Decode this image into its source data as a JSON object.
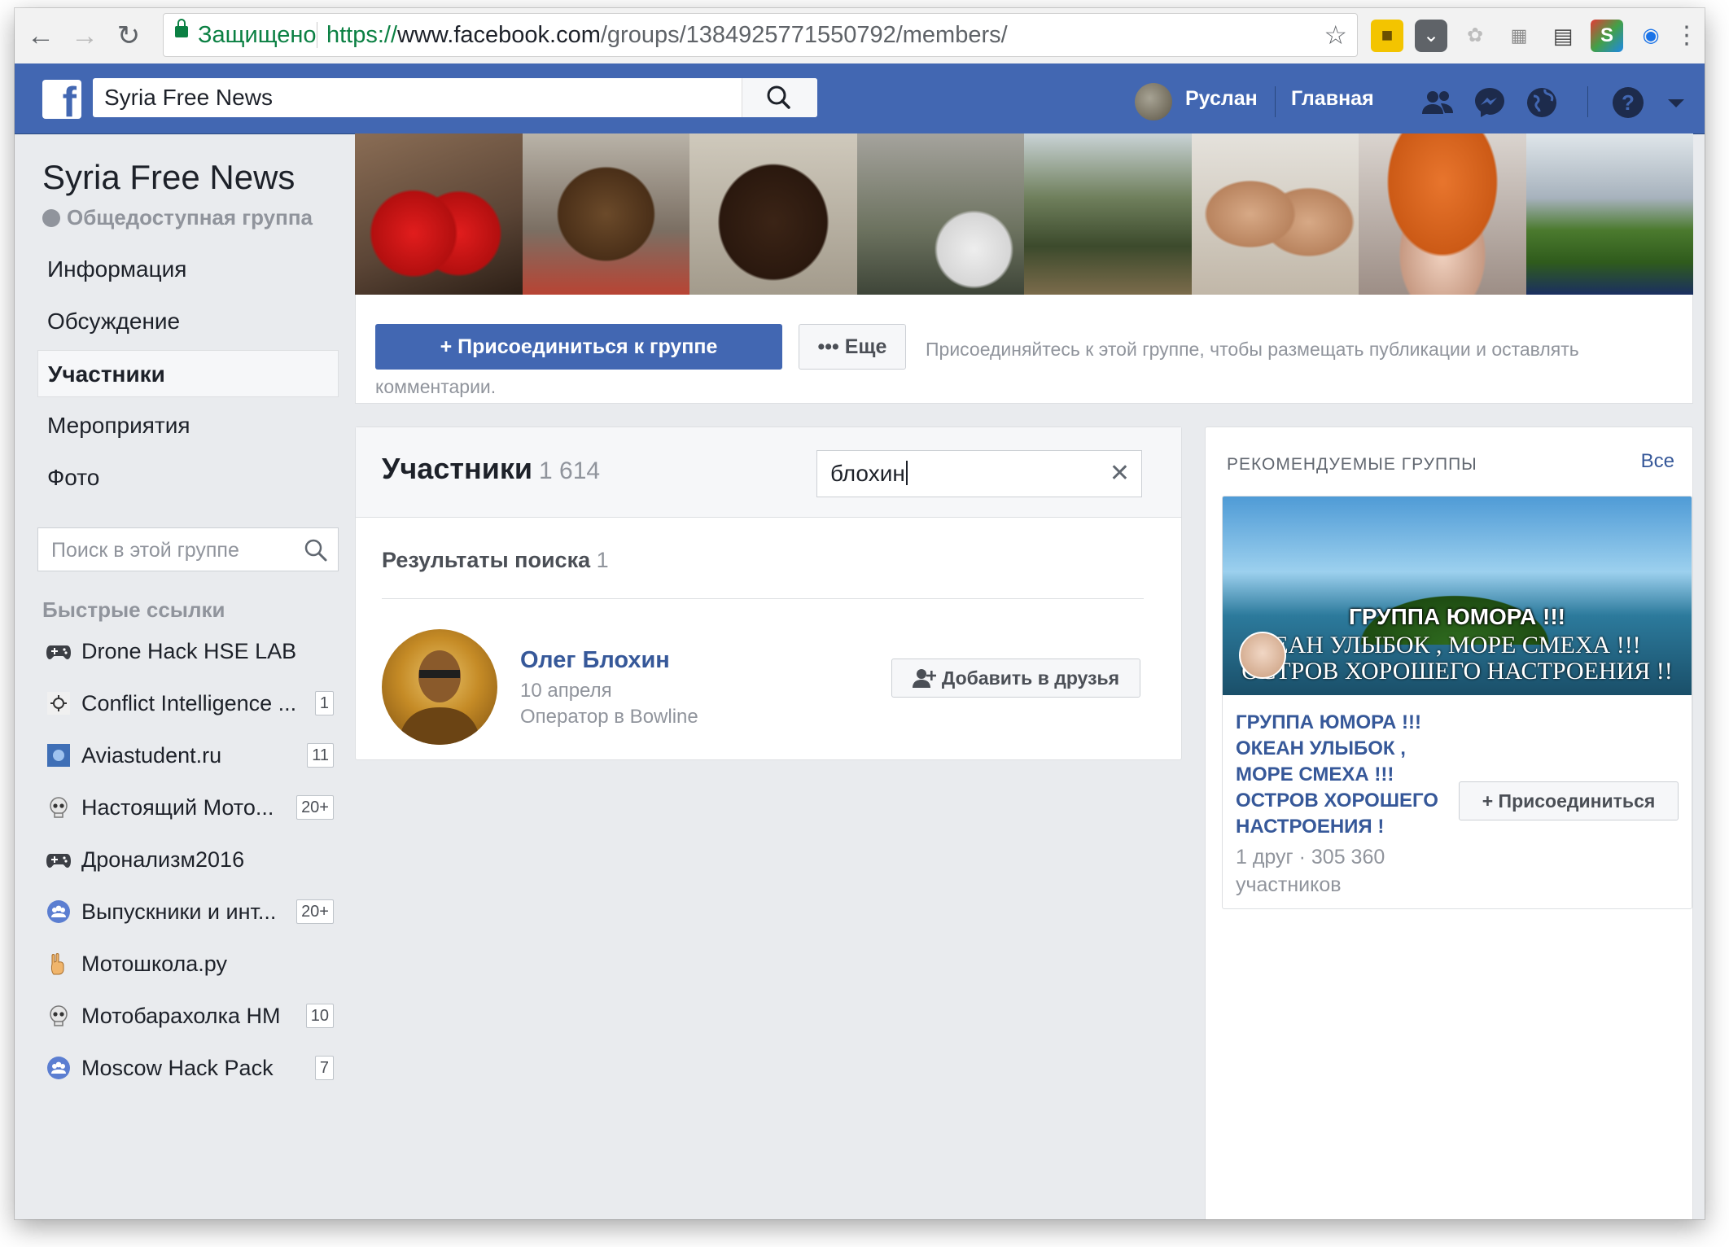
{
  "browser": {
    "secure_label": "Защищено",
    "url_proto": "https://",
    "url_host": "www.facebook.com",
    "url_path": "/groups/1384925771550792/members/"
  },
  "topbar": {
    "search_value": "Syria Free News",
    "user_name": "Руслан",
    "home_label": "Главная"
  },
  "group": {
    "title": "Syria Free News",
    "type": "Общедоступная группа",
    "nav": [
      "Информация",
      "Обсуждение",
      "Участники",
      "Мероприятия",
      "Фото"
    ],
    "search_placeholder": "Поиск в этой группе"
  },
  "quick_links": {
    "title": "Быстрые ссылки",
    "items": [
      {
        "label": "Drone Hack HSE LAB",
        "count": ""
      },
      {
        "label": "Conflict Intelligence ...",
        "count": "1"
      },
      {
        "label": "Aviastudent.ru",
        "count": "11"
      },
      {
        "label": "Настоящий Мото...",
        "count": "20+"
      },
      {
        "label": "Дронализм2016",
        "count": ""
      },
      {
        "label": "Выпускники и инт...",
        "count": "20+"
      },
      {
        "label": "Мотошкола.ру",
        "count": ""
      },
      {
        "label": "Мотобарахолка НМ",
        "count": "10"
      },
      {
        "label": "Moscow Hack Pack",
        "count": "7"
      }
    ]
  },
  "join": {
    "button": "+ Присоединиться к группе",
    "more": "••• Еще",
    "note": "Присоединяйтесь к этой группе, чтобы размещать публикации и оставлять комментарии."
  },
  "members": {
    "title": "Участники",
    "count": "1 614",
    "search_value": "блохин",
    "results_label": "Результаты поиска",
    "results_count": "1",
    "person": {
      "name": "Олег Блохин",
      "date": "10 апреля",
      "job": "Оператор в Bowline",
      "add_friend": "Добавить в друзья"
    }
  },
  "recommended": {
    "title": "РЕКОМЕНДУЕМЫЕ ГРУППЫ",
    "all": "Все",
    "image_line1": "ГРУППА ЮМОРА !!!",
    "image_line2": "ЕАН УЛЫБОК , МОРЕ СМЕХА !!!",
    "image_line3": "ОСТРОВ ХОРОШЕГО НАСТРОЕНИЯ !!",
    "name": "ГРУППА ЮМОРА !!! ОКЕАН УЛЫБОК , МОРЕ СМЕХА !!! ОСТРОВ ХОРОШЕГО НАСТРОЕНИЯ !",
    "meta": "1 друг · 305 360 участников",
    "join": "+ Присоединиться"
  },
  "colors": {
    "fb_blue": "#4267b2",
    "link_blue": "#365899",
    "secure_green": "#0b8043"
  }
}
